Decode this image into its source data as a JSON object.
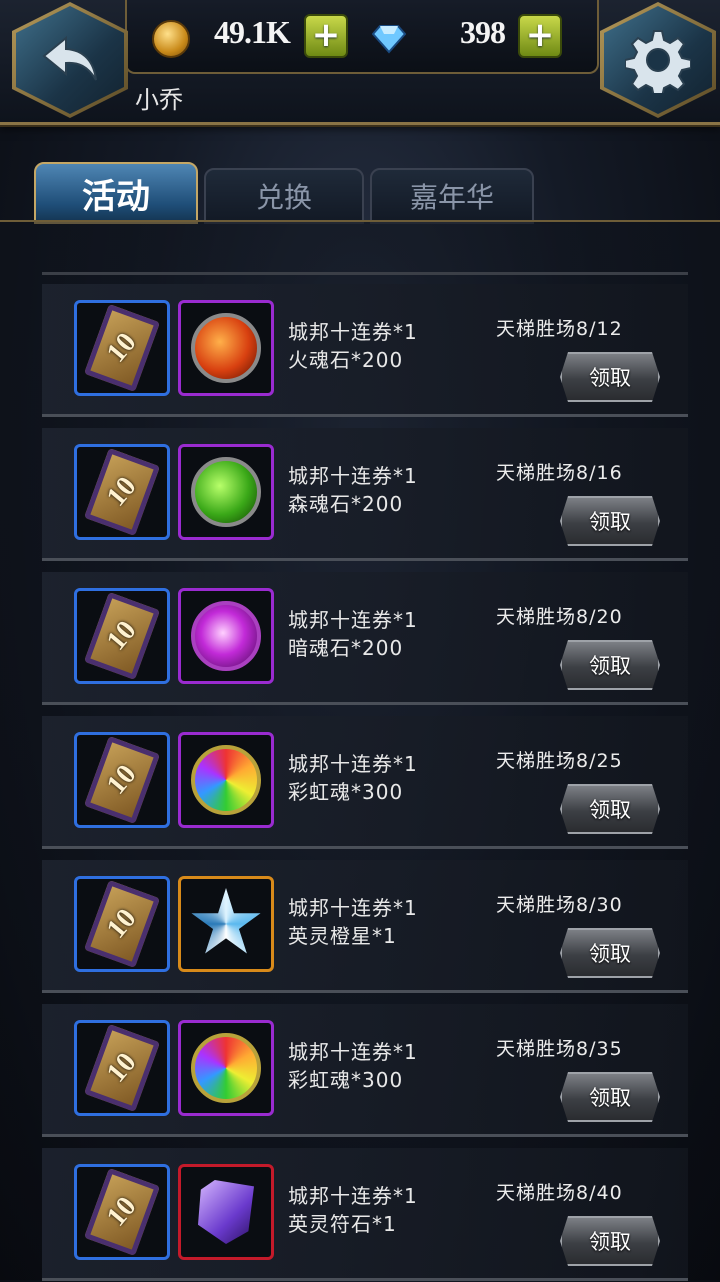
{
  "header": {
    "gold_value": "49.1K",
    "diamond_value": "398",
    "plus_label": "+",
    "username": "小乔"
  },
  "tabs": [
    {
      "label": "活动",
      "active": true
    },
    {
      "label": "兑换",
      "active": false
    },
    {
      "label": "嘉年华",
      "active": false
    }
  ],
  "rows": [
    {
      "ticket_num": "10",
      "line1": "城邦十连券*1",
      "line2": "火魂石*200",
      "req": "天梯胜场8/12",
      "btn": "领取",
      "item_icon": "fire-soul-stone-icon"
    },
    {
      "ticket_num": "10",
      "line1": "城邦十连券*1",
      "line2": "森魂石*200",
      "req": "天梯胜场8/16",
      "btn": "领取",
      "item_icon": "forest-soul-stone-icon"
    },
    {
      "ticket_num": "10",
      "line1": "城邦十连券*1",
      "line2": "暗魂石*200",
      "req": "天梯胜场8/20",
      "btn": "领取",
      "item_icon": "dark-soul-stone-icon"
    },
    {
      "ticket_num": "10",
      "line1": "城邦十连券*1",
      "line2": "彩虹魂*300",
      "req": "天梯胜场8/25",
      "btn": "领取",
      "item_icon": "rainbow-soul-icon"
    },
    {
      "ticket_num": "10",
      "line1": "城邦十连券*1",
      "line2": "英灵橙星*1",
      "req": "天梯胜场8/30",
      "btn": "领取",
      "item_icon": "hero-orange-star-icon"
    },
    {
      "ticket_num": "10",
      "line1": "城邦十连券*1",
      "line2": "彩虹魂*300",
      "req": "天梯胜场8/35",
      "btn": "领取",
      "item_icon": "rainbow-soul-icon"
    },
    {
      "ticket_num": "10",
      "line1": "城邦十连券*1",
      "line2": "英灵符石*1",
      "req": "天梯胜场8/40",
      "btn": "领取",
      "item_icon": "hero-rune-stone-icon"
    }
  ],
  "colors": {
    "accent_gold": "#c4a766",
    "active_tab": "#2a5f8e",
    "ticket_border": "#2f6fe0",
    "purple_border": "#9a2bd0",
    "orange_border": "#d88a1a",
    "red_border": "#c41a2a"
  }
}
